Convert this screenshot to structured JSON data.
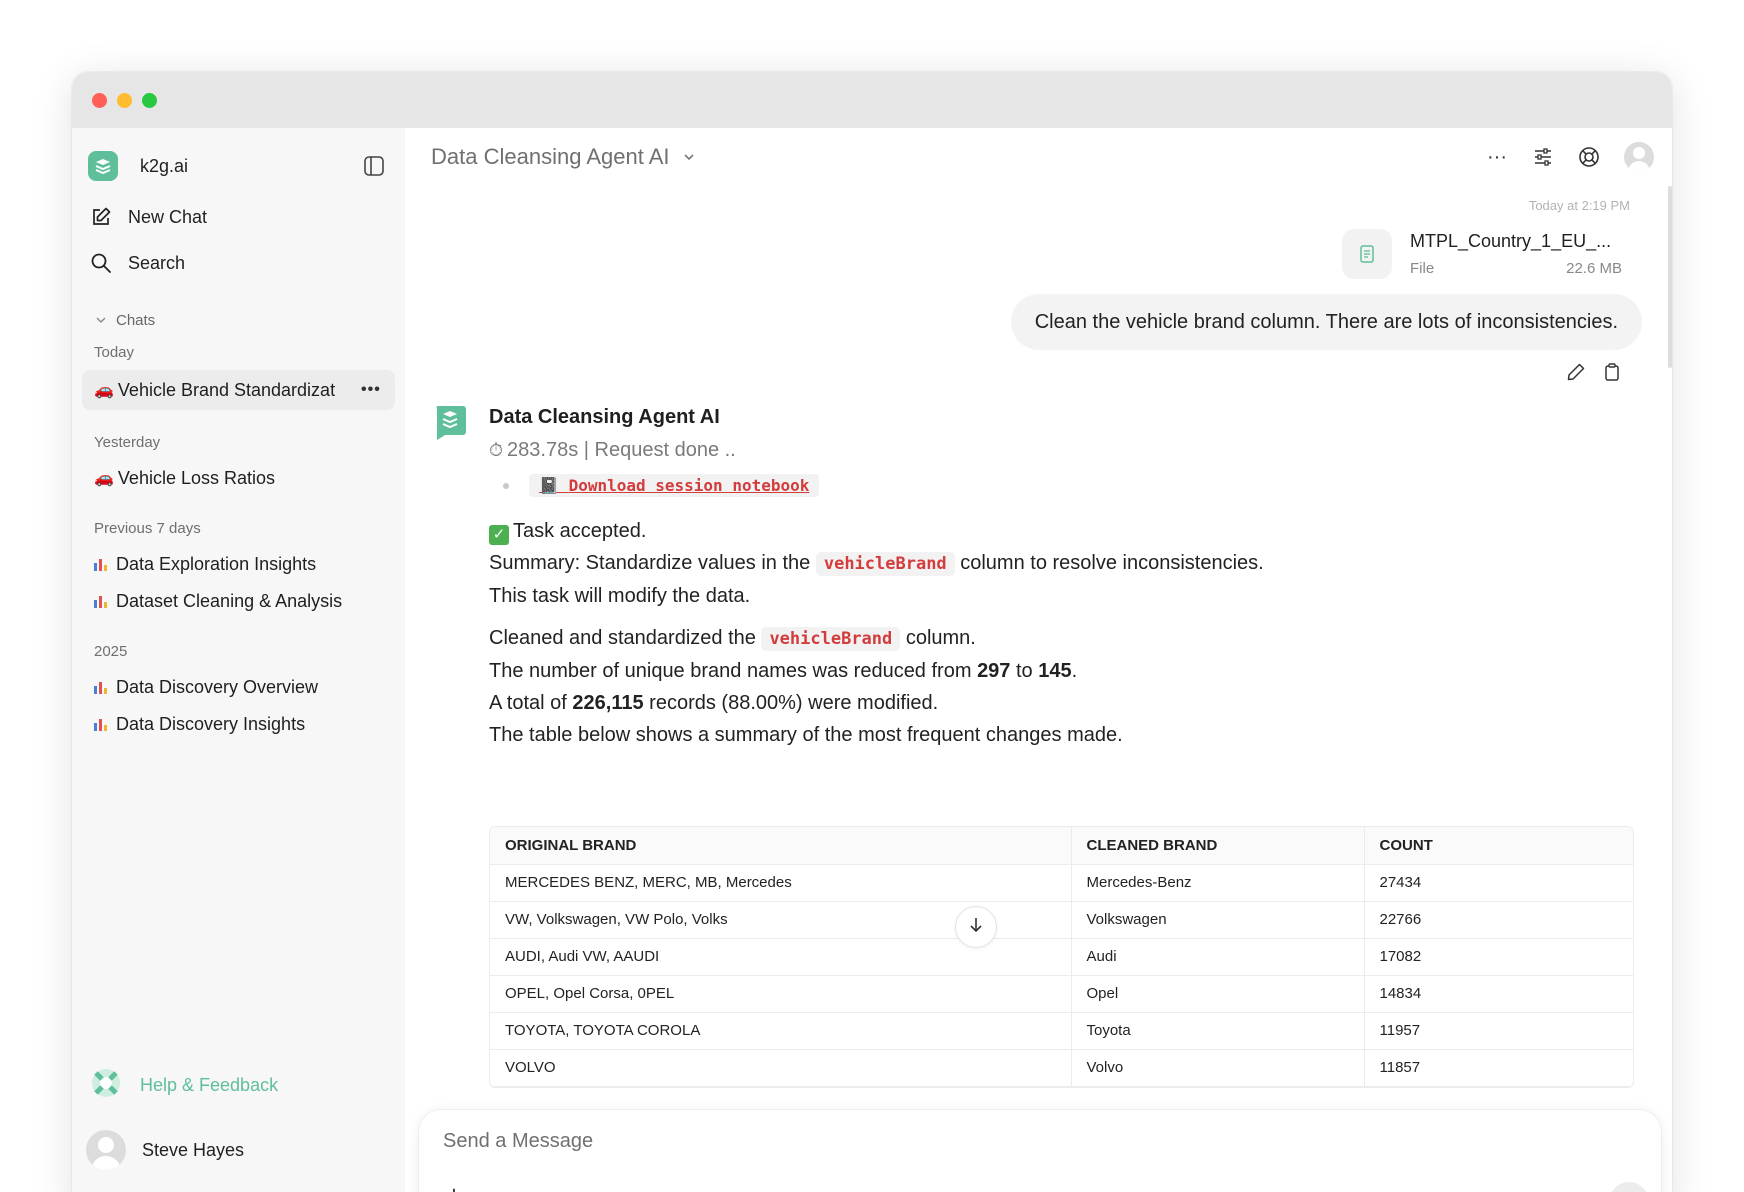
{
  "window": {
    "controls": [
      "close",
      "minimize",
      "zoom"
    ]
  },
  "sidebar": {
    "brand_name": "k2g.ai",
    "new_chat_label": "New Chat",
    "search_label": "Search",
    "chats_section_label": "Chats",
    "groups": [
      {
        "label": "Today",
        "items": [
          {
            "icon": "car-emoji",
            "emoji": "🚗",
            "title": "Vehicle Brand Standardizat",
            "active": true
          }
        ]
      },
      {
        "label": "Yesterday",
        "items": [
          {
            "icon": "car-emoji",
            "emoji": "🚗",
            "title": "Vehicle Loss Ratios"
          }
        ]
      },
      {
        "label": "Previous 7 days",
        "items": [
          {
            "icon": "bar-chart-emoji",
            "title": "Data Exploration Insights"
          },
          {
            "icon": "bar-chart-emoji",
            "title": "Dataset Cleaning & Analysis"
          }
        ]
      },
      {
        "label": "2025",
        "items": [
          {
            "icon": "bar-chart-emoji",
            "title": "Data Discovery Overview"
          },
          {
            "icon": "bar-chart-emoji",
            "title": "Data Discovery Insights"
          }
        ]
      }
    ],
    "more_label": "•••",
    "help_label": "Help & Feedback",
    "user_name": "Steve Hayes"
  },
  "header": {
    "model_name": "Data Cleansing Agent AI",
    "more_label": "···"
  },
  "conversation": {
    "timestamp": "Today at 2:19 PM",
    "file": {
      "name": "MTPL_Country_1_EU_...",
      "type": "File",
      "size": "22.6 MB"
    },
    "user_message": "Clean the vehicle brand column. There are lots of inconsistencies.",
    "assistant": {
      "name": "Data Cleansing Agent AI",
      "status_timer": "⏱",
      "status": "283.78s | Request done ..",
      "download_emoji": "📓",
      "download_label": "Download session notebook",
      "task_accepted": "Task accepted.",
      "summary_prefix": "Summary: Standardize values in the",
      "summary_code": "vehicleBrand",
      "summary_suffix": "column to resolve inconsistencies.",
      "modify_note": "This task will modify the data.",
      "cleaned_prefix": "Cleaned and standardized the",
      "cleaned_code": "vehicleBrand",
      "cleaned_suffix": "column.",
      "unique_prefix": "The number of unique brand names was reduced from",
      "unique_from": "297",
      "unique_mid": "to",
      "unique_to": "145",
      "unique_end": ".",
      "total_prefix": "A total of",
      "total_count": "226,115",
      "total_suffix": "records (88.00%) were modified.",
      "table_intro": "The table below shows a summary of the most frequent changes made."
    },
    "table": {
      "headers": [
        "ORIGINAL BRAND",
        "CLEANED BRAND",
        "COUNT"
      ],
      "rows": [
        [
          "MERCEDES BENZ, MERC, MB, Mercedes",
          "Mercedes-Benz",
          "27434"
        ],
        [
          "VW, Volkswagen, VW Polo, Volks",
          "Volkswagen",
          "22766"
        ],
        [
          "AUDI, Audi VW, AAUDI",
          "Audi",
          "17082"
        ],
        [
          "OPEL, Opel Corsa, 0PEL",
          "Opel",
          "14834"
        ],
        [
          "TOYOTA, TOYOTA COROLA",
          "Toyota",
          "11957"
        ],
        [
          "VOLVO",
          "Volvo",
          "11857"
        ]
      ]
    }
  },
  "composer": {
    "placeholder": "Send a Message",
    "plus_label": "+"
  },
  "colors": {
    "accent": "#5fbf9a",
    "code_text": "#d33c3c",
    "sidebar_bg": "#f7f7f7",
    "active_chat_bg": "#ececec"
  }
}
